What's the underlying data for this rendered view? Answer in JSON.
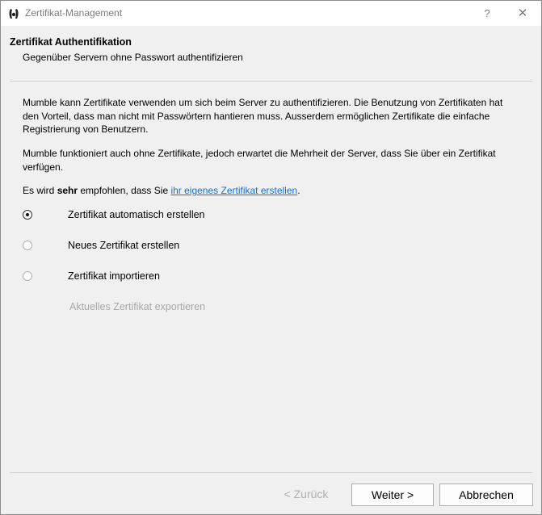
{
  "window": {
    "title": "Zertifikat-Management",
    "help_label": "?",
    "close_label": "✕"
  },
  "header": {
    "title": "Zertifikat Authentifikation",
    "subtitle": "Gegenüber Servern ohne Passwort authentifizieren"
  },
  "body": {
    "paragraph1": "Mumble kann Zertifikate verwenden um sich beim Server zu authentifizieren. Die Benutzung von Zertifikaten hat den Vorteil, dass man nicht mit Passwörtern hantieren muss. Ausserdem ermöglichen Zertifikate die einfache Registrierung von Benutzern.",
    "paragraph2": "Mumble funktioniert auch ohne Zertifikate, jedoch erwartet die Mehrheit der Server, dass Sie über ein Zertifikat verfügen.",
    "recommend_prefix": "Es wird ",
    "recommend_bold": "sehr",
    "recommend_middle": " empfohlen, dass Sie ",
    "recommend_link": "ihr eigenes Zertifikat erstellen",
    "recommend_suffix": "."
  },
  "options": [
    {
      "label": "Zertifikat automatisch erstellen",
      "checked": true
    },
    {
      "label": "Neues Zertifikat erstellen",
      "checked": false
    },
    {
      "label": "Zertifikat importieren",
      "checked": false
    }
  ],
  "export_option": {
    "label": "Aktuelles Zertifikat exportieren",
    "enabled": false
  },
  "footer": {
    "back_label": "< Zurück",
    "next_label": "Weiter >",
    "cancel_label": "Abbrechen"
  },
  "colors": {
    "link": "#1a6fc2",
    "disabled_text": "#a8a8a8",
    "dialog_bg": "#f0f0f0"
  }
}
